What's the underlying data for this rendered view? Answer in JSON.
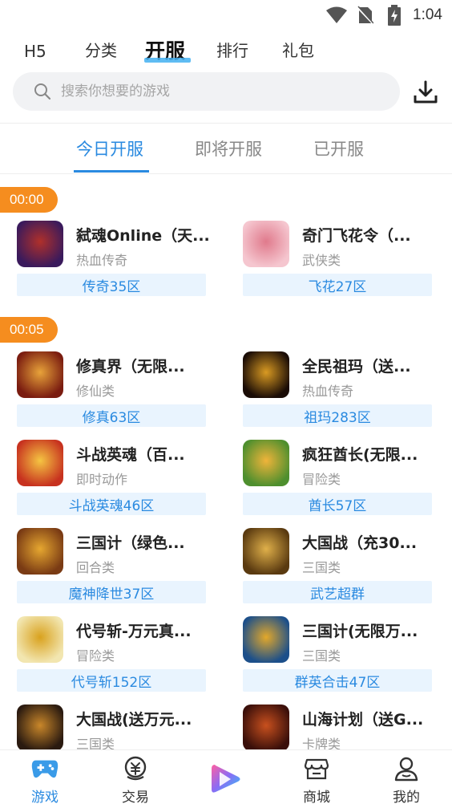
{
  "status_bar": {
    "time": "1:04",
    "icons": [
      "wifi-icon",
      "no-sim-icon",
      "battery-charging-icon"
    ]
  },
  "top_nav": {
    "items": [
      "H5",
      "分类",
      "开服",
      "排行",
      "礼包"
    ],
    "active": "开服"
  },
  "search": {
    "placeholder": "搜索你想要的游戏",
    "icon": "search-icon"
  },
  "download_icon": "download-icon",
  "sub_tabs": {
    "items": [
      "今日开服",
      "即将开服",
      "已开服"
    ],
    "active": "今日开服"
  },
  "groups": [
    {
      "time": "00:00",
      "games": [
        {
          "name": "弑魂Online（天...",
          "category": "热血传奇",
          "server": "传奇35区",
          "colors": [
            "#3a1a5c",
            "#b0302a"
          ]
        },
        {
          "name": "奇门飞花令（...",
          "category": "武侠类",
          "server": "飞花27区",
          "colors": [
            "#f5c6cf",
            "#e07a8c"
          ]
        }
      ]
    },
    {
      "time": "00:05",
      "games": [
        {
          "name": "修真界（无限...",
          "category": "修仙类",
          "server": "修真63区",
          "colors": [
            "#7a1c10",
            "#e8a33a"
          ]
        },
        {
          "name": "全民祖玛（送...",
          "category": "热血传奇",
          "server": "祖玛283区",
          "colors": [
            "#1a0c06",
            "#d99a22"
          ]
        },
        {
          "name": "斗战英魂（百...",
          "category": "即时动作",
          "server": "斗战英魂46区",
          "colors": [
            "#c7321f",
            "#f5c542"
          ]
        },
        {
          "name": "疯狂酋长(无限...",
          "category": "冒险类",
          "server": "酋长57区",
          "colors": [
            "#4e8f2e",
            "#f0b43a"
          ]
        },
        {
          "name": "三国计（绿色...",
          "category": "回合类",
          "server": "魔神降世37区",
          "colors": [
            "#7a3b14",
            "#e6a730"
          ]
        },
        {
          "name": "大国战（充30...",
          "category": "三国类",
          "server": "武艺超群",
          "colors": [
            "#5a3a10",
            "#e0b04a"
          ]
        },
        {
          "name": "代号斩-万元真...",
          "category": "冒险类",
          "server": "代号斩152区",
          "colors": [
            "#f2e6b0",
            "#d9a21e"
          ]
        },
        {
          "name": "三国计(无限万...",
          "category": "三国类",
          "server": "群英合击47区",
          "colors": [
            "#1c4f8a",
            "#e3a82a"
          ]
        },
        {
          "name": "大国战(送万元...",
          "category": "三国类",
          "server": "",
          "colors": [
            "#2a1a10",
            "#c9872a"
          ]
        },
        {
          "name": "山海计划（送G...",
          "category": "卡牌类",
          "server": "",
          "colors": [
            "#3a0f0a",
            "#c8501e"
          ]
        }
      ]
    }
  ],
  "bottom_nav": [
    {
      "label": "游戏",
      "icon": "gamepad-icon",
      "active": true
    },
    {
      "label": "交易",
      "icon": "trade-icon",
      "active": false
    },
    {
      "label": "",
      "icon": "play-icon",
      "active": false
    },
    {
      "label": "商城",
      "icon": "store-icon",
      "active": false
    },
    {
      "label": "我的",
      "icon": "user-icon",
      "active": false
    }
  ],
  "colors": {
    "accent": "#2a8ae0",
    "time_badge": "#f58d1f",
    "tag_bg": "#e9f4fe"
  }
}
